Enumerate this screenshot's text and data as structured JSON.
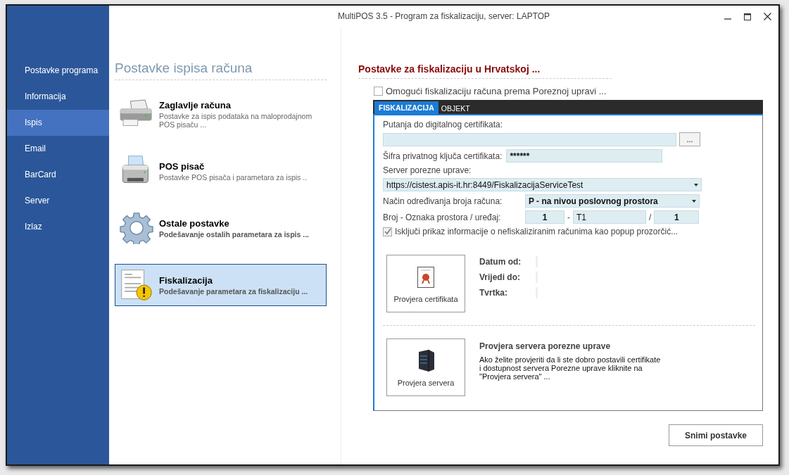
{
  "window": {
    "title": "MultiPOS 3.5 - Program za fiskalizaciju, server: LAPTOP"
  },
  "sidebar": {
    "items": [
      {
        "label": "Postavke programa",
        "selected": false
      },
      {
        "label": "Informacija",
        "selected": false
      },
      {
        "label": "Ispis",
        "selected": true
      },
      {
        "label": "Email",
        "selected": false
      },
      {
        "label": "BarCard",
        "selected": false
      },
      {
        "label": "Server",
        "selected": false
      },
      {
        "label": "Izlaz",
        "selected": false
      }
    ]
  },
  "print_settings": {
    "title": "Postavke ispisa računa",
    "items": [
      {
        "kind": "header",
        "title": "Zaglavlje računa",
        "description": "Postavke za ispis podataka na maloprodajnom POS pisaču ...",
        "selected": false
      },
      {
        "kind": "printer",
        "title": "POS pisač",
        "description": "Postavke POS pisača i parametara za ispis ..",
        "selected": false
      },
      {
        "kind": "other",
        "title": "Ostale postavke",
        "description": "Podešavanje ostalih parametara za ispis ...",
        "selected": false
      },
      {
        "kind": "fiscal",
        "title": "Fiskalizacija",
        "description": "Podešavanje parametara za fiskalizaciju ...",
        "selected": true
      }
    ]
  },
  "fiscal": {
    "title": "Postavke za fiskalizaciju u Hrvatskoj ...",
    "enable": {
      "label": "Omogući fiskalizaciju računa prema Poreznoj upravi ...",
      "checked": false
    },
    "tabs": [
      {
        "label": "FISKALIZACIJA",
        "selected": true
      },
      {
        "label": "OBJEKT",
        "selected": false
      }
    ],
    "certificate_path": {
      "label": "Putanja do digitalnog certifikata:",
      "browse": "..."
    },
    "key_password": {
      "label": "Šifra privatnog ključa certifikata:",
      "value": "******"
    },
    "server": {
      "label": "Server porezne uprave:",
      "value": "https://cistest.apis-it.hr:8449/FiskalizacijaServiceTest"
    },
    "numbering": {
      "label": "Način određivanja broja računa:",
      "value": "P - na nivou poslovnog prostora"
    },
    "number": {
      "label": "Broj - Oznaka prostora / uređaj:",
      "number": "1",
      "sep1": "-",
      "premise": "T1",
      "sep2": "/",
      "device": "1"
    },
    "disable_popup": {
      "label": "Isključi prikaz informacije o nefiskaliziranim računima kao popup prozorčić...",
      "checked": true
    },
    "cert_check": {
      "button": "Provjera certifikata",
      "fields": [
        "Datum od:",
        "Vrijedi do:",
        "Tvrtka:"
      ]
    },
    "server_check": {
      "button": "Provjera servera",
      "title": "Provjera servera porezne uprave",
      "description": [
        "Ako želite provjeriti da li ste dobro postavili certifikate",
        "i dostupnost servera Porezne uprave kliknite na",
        "\"Provjera servera\" ..."
      ]
    }
  },
  "save_button": "Snimi postavke"
}
